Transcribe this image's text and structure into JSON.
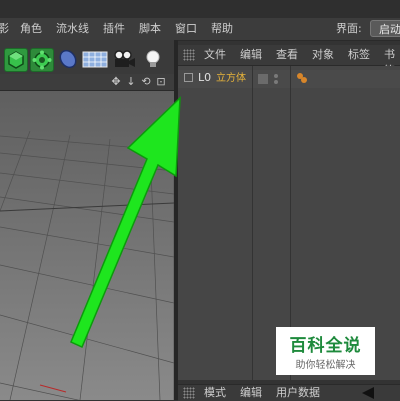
{
  "menubar": {
    "items": [
      "影",
      "角色",
      "流水线",
      "插件",
      "脚本",
      "窗口",
      "帮助"
    ],
    "layout_label": "界面:",
    "layout_value": "启动"
  },
  "toolbar": {
    "icons": [
      "cube-green-icon",
      "gear-green-icon",
      "capsule-blue-icon",
      "floor-grid-icon",
      "camera-icon",
      "light-bulb-icon"
    ]
  },
  "viewport": {
    "controls": [
      "✥",
      "↓",
      "⟲",
      "⊡"
    ]
  },
  "object_manager": {
    "menu": [
      "文件",
      "编辑",
      "查看",
      "对象",
      "标签",
      "书签"
    ],
    "objects": [
      {
        "layer": "L0",
        "name": "立方体"
      }
    ],
    "bottom_tabs": [
      "模式",
      "编辑",
      "用户数据"
    ]
  },
  "watermark": {
    "title": "百科全说",
    "subtitle": "助你轻松解决"
  },
  "colors": {
    "arrow": "#1ee61e",
    "object_name": "#e8b43a",
    "menu_bg": "#3c3c3c",
    "panel_bg": "#464646"
  }
}
